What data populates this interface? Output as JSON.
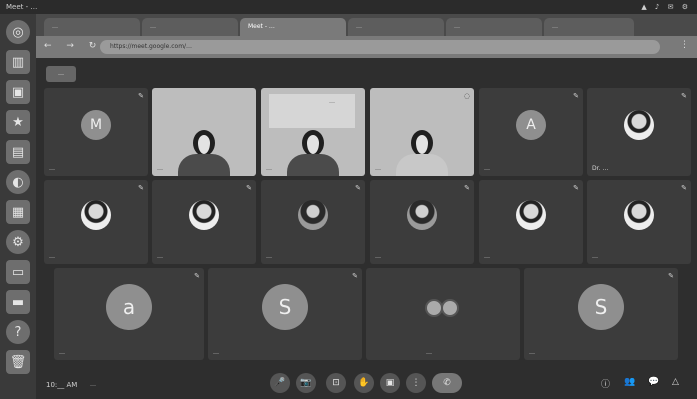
{
  "topbar": {
    "title": "Meet - …",
    "tray": "▲ ♪ ✉ ⚙"
  },
  "launcher": {
    "items": [
      {
        "icon": "ubuntu-icon",
        "glyph": "◎"
      },
      {
        "icon": "files-icon",
        "glyph": "▥"
      },
      {
        "icon": "terminal-icon",
        "glyph": "▣"
      },
      {
        "icon": "star-icon",
        "glyph": "★"
      },
      {
        "icon": "document-icon",
        "glyph": "▤"
      },
      {
        "icon": "browser-icon",
        "glyph": "◐"
      },
      {
        "icon": "spreadsheet-icon",
        "glyph": "▦"
      },
      {
        "icon": "settings-icon",
        "glyph": "⚙"
      },
      {
        "icon": "store-icon",
        "glyph": "▭"
      },
      {
        "icon": "drive-icon",
        "glyph": "▬"
      },
      {
        "icon": "help-icon",
        "glyph": "?"
      },
      {
        "icon": "trash-icon",
        "glyph": "🗑"
      }
    ]
  },
  "browser": {
    "tabs": [
      {
        "label": "…"
      },
      {
        "label": "…"
      },
      {
        "label": "Meet - …",
        "active": true
      },
      {
        "label": "…"
      },
      {
        "label": "…"
      },
      {
        "label": "…"
      }
    ],
    "nav": "← → ↻",
    "url": "https://meet.google.com/…",
    "menu": "⋮"
  },
  "meet": {
    "hosts_chip": "…",
    "tiles": [
      {
        "kind": "avatar",
        "initial": "M",
        "name": "…"
      },
      {
        "kind": "video",
        "name": "…"
      },
      {
        "kind": "video-board",
        "name": "…",
        "board_text": "…"
      },
      {
        "kind": "video",
        "name": "…"
      },
      {
        "kind": "avatar",
        "initial": "A",
        "name": "…"
      },
      {
        "kind": "photo",
        "name": "Dr. …"
      },
      {
        "kind": "photo",
        "name": "…"
      },
      {
        "kind": "photo",
        "name": "…"
      },
      {
        "kind": "photo-dark",
        "name": "…"
      },
      {
        "kind": "photo-dark",
        "name": "…"
      },
      {
        "kind": "photo",
        "name": "…"
      },
      {
        "kind": "photo",
        "name": "…"
      },
      {
        "kind": "avatar-big",
        "initial": "a",
        "name": "…"
      },
      {
        "kind": "avatar-big",
        "initial": "S",
        "name": "…"
      },
      {
        "kind": "duo",
        "name": "…"
      },
      {
        "kind": "avatar-big",
        "initial": "S",
        "name": "…"
      }
    ],
    "bottom": {
      "time": "10:__ AM",
      "meeting_code": "…",
      "controls": [
        "🎤",
        "📷",
        "⊡",
        "✋",
        "▣",
        "⋮",
        "✆"
      ],
      "right_icons": [
        "ⓘ",
        "👥",
        "💬",
        "△"
      ]
    }
  }
}
